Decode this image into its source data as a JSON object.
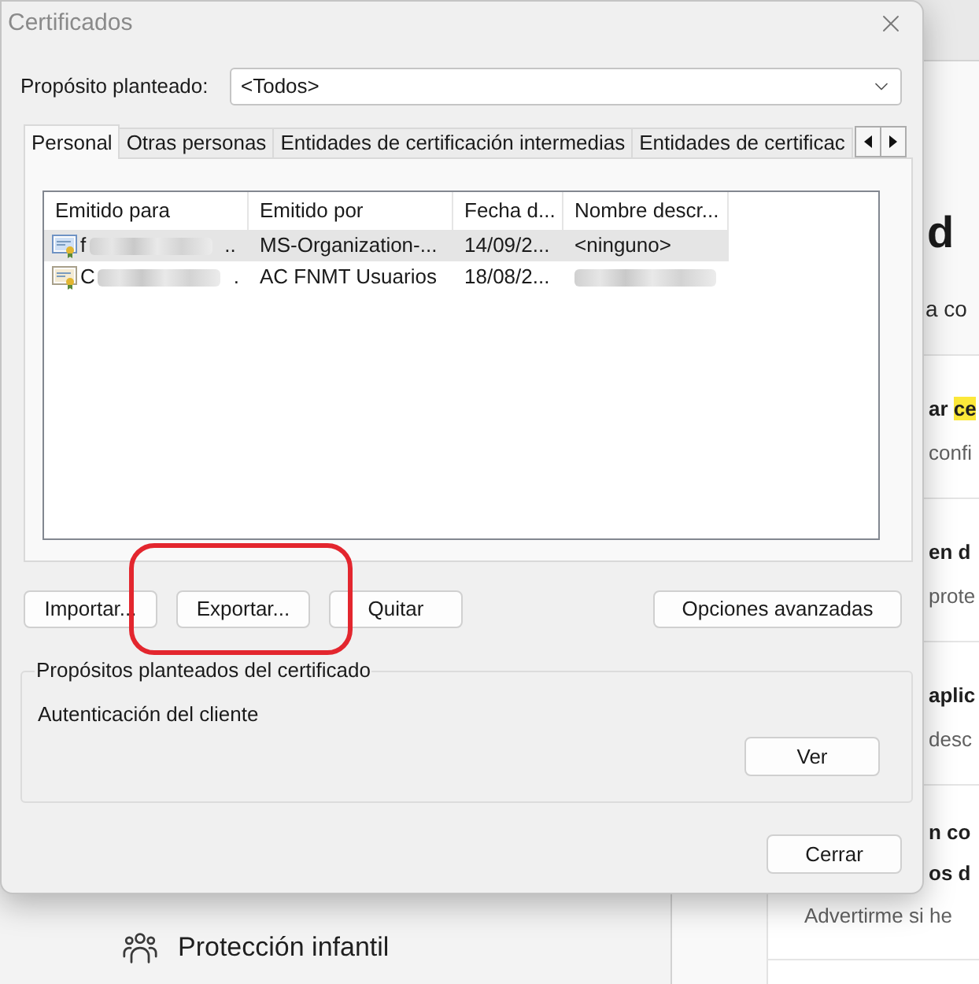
{
  "window": {
    "title": "Certificados"
  },
  "purpose": {
    "label": "Propósito planteado:",
    "value": "<Todos>"
  },
  "tabs": [
    {
      "label": "Personal",
      "selected": true
    },
    {
      "label": "Otras personas",
      "selected": false
    },
    {
      "label": "Entidades de certificación intermedias",
      "selected": false
    },
    {
      "label": "Entidades de certificac",
      "selected": false
    }
  ],
  "certificates": {
    "columns": [
      "Emitido para",
      "Emitido por",
      "Fecha d...",
      "Nombre descr..."
    ],
    "rows": [
      {
        "selected": true,
        "issued_to": {
          "start": "f",
          "redacted": true,
          "end": ".."
        },
        "issued_by": "MS-Organization-...",
        "date": "14/09/2...",
        "friendly_name": {
          "text": "<ninguno>",
          "redacted": false
        }
      },
      {
        "selected": false,
        "issued_to": {
          "start": "C",
          "redacted": true,
          "end": "."
        },
        "issued_by": "AC FNMT Usuarios",
        "date": "18/08/2...",
        "friendly_name": {
          "redacted": true
        }
      }
    ]
  },
  "buttons": [
    {
      "label": "Importar...",
      "highlighted": false
    },
    {
      "label": "Exportar...",
      "highlighted": true
    },
    {
      "label": "Quitar",
      "highlighted": false
    }
  ],
  "advanced_button": "Opciones avanzadas",
  "purposes_group": {
    "title": "Propósitos planteados del certificado",
    "text": "Autenticación del cliente",
    "view_button": "Ver"
  },
  "close_button": "Cerrar",
  "background": {
    "sidebar_items": [
      {
        "label": "Protección infantil"
      }
    ],
    "heading": "d",
    "subheading": "a co",
    "settings_rows": [
      {
        "title_lines": [
          [
            {
              "text": "ar",
              "highlighted": false
            },
            {
              "text": "ce",
              "highlighted": true
            }
          ]
        ],
        "description": "confi"
      },
      {
        "title_lines": [
          [
            {
              "text": "en d",
              "highlighted": false
            }
          ]
        ],
        "description": "prote"
      },
      {
        "title_lines": [
          [
            {
              "text": "aplic",
              "highlighted": false
            }
          ]
        ],
        "description": "desc"
      },
      {
        "title_lines": [
          [
            {
              "text": "n co",
              "highlighted": false
            }
          ],
          [
            {
              "text": "os d",
              "highlighted": false
            }
          ]
        ],
        "description": "Advertirme si he"
      }
    ]
  }
}
